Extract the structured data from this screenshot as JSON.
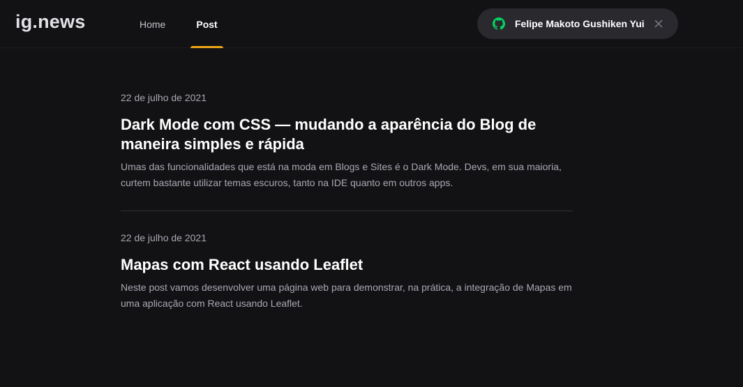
{
  "header": {
    "logo": "ig.news",
    "nav": [
      {
        "label": "Home",
        "active": false
      },
      {
        "label": "Post",
        "active": true
      }
    ],
    "user": {
      "name": "Felipe Makoto Gushiken Yui",
      "icon": "github-icon",
      "icon_color": "#04d361",
      "close_icon": "close-icon"
    },
    "accent_color": "#eba417"
  },
  "posts": [
    {
      "date": "22 de julho de 2021",
      "title": "Dark Mode com CSS — mudando a aparência do Blog de maneira simples e rápida",
      "excerpt": "Umas das funcionalidades que está na moda em Blogs e Sites é o Dark Mode. Devs, em sua maioria, curtem bastante utilizar temas escuros, tanto na IDE quanto em outros apps."
    },
    {
      "date": "22 de julho de 2021",
      "title": "Mapas com React usando Leaflet",
      "excerpt": "Neste post vamos desenvolver uma página web para demonstrar, na prática, a integração de Mapas em uma aplicação com React usando Leaflet."
    }
  ]
}
